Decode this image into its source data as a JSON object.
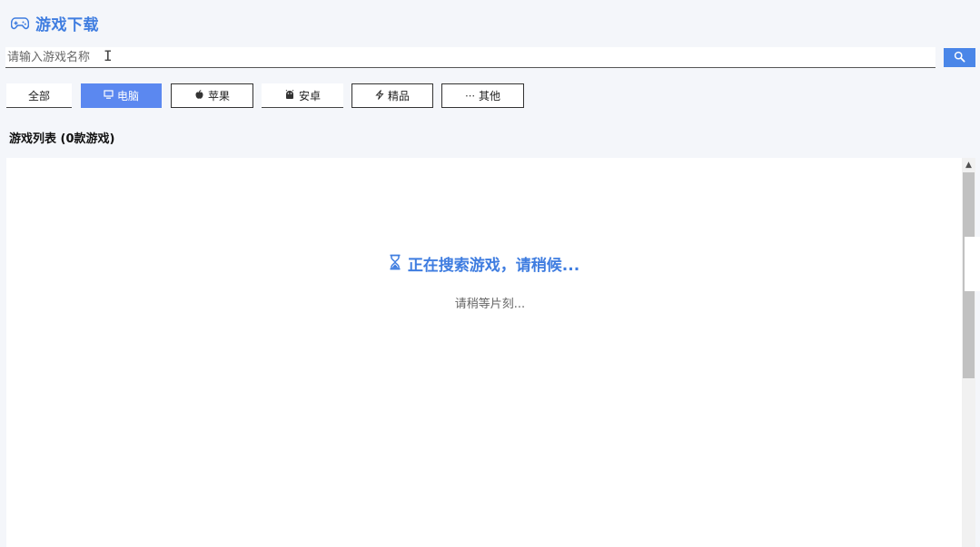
{
  "header": {
    "title": "游戏下载",
    "icon": "gamepad-icon",
    "accent_color": "#3f7de0"
  },
  "search": {
    "placeholder": "请输入游戏名称",
    "value": "",
    "button_icon": "search-icon",
    "button_color": "#4a86e8"
  },
  "tabs": [
    {
      "label": "全部",
      "icon": "",
      "active": false
    },
    {
      "label": "电脑",
      "icon": "monitor-icon",
      "active": true
    },
    {
      "label": "苹果",
      "icon": "apple-icon",
      "active": false
    },
    {
      "label": "安卓",
      "icon": "android-icon",
      "active": false
    },
    {
      "label": "精品",
      "icon": "lightning-icon",
      "active": false
    },
    {
      "label": "其他",
      "icon": "ellipsis-icon",
      "active": false
    }
  ],
  "list": {
    "heading": "游戏列表 (0款游戏)"
  },
  "loading": {
    "icon": "hourglass-icon",
    "text": "正在搜索游戏，请稍候...",
    "subtext": "请稍等片刻..."
  },
  "active_tab_color": "#5b88f0"
}
